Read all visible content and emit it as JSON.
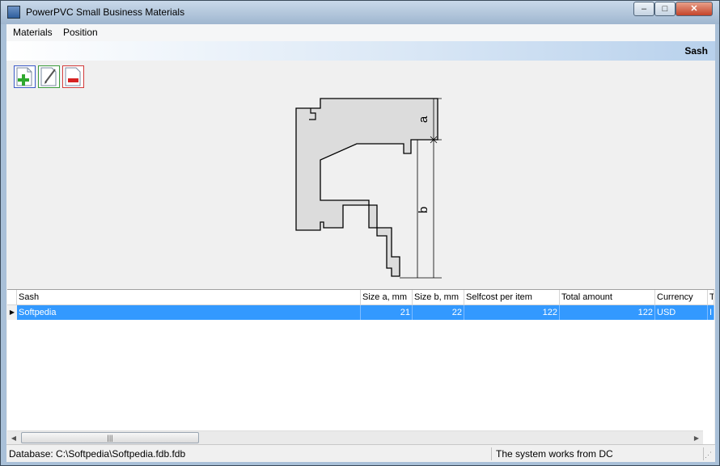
{
  "window": {
    "title": "PowerPVC Small Business Materials",
    "minimize": "–",
    "maximize": "□",
    "close": "✕"
  },
  "menu": {
    "items": [
      "Materials",
      "Position"
    ]
  },
  "banner": {
    "title": "Sash"
  },
  "toolbar": {
    "add_icon": "add-icon",
    "edit_icon": "edit-icon",
    "delete_icon": "delete-icon"
  },
  "drawing": {
    "label_a": "a",
    "label_b": "b"
  },
  "grid": {
    "columns": [
      "Sash",
      "Size a, mm",
      "Size b, mm",
      "Selfcost per item",
      "Total amount",
      "Currency",
      "T"
    ],
    "rows": [
      {
        "name": "Softpedia",
        "size_a": "21",
        "size_b": "22",
        "selfcost": "122",
        "total": "122",
        "currency": "USD",
        "t": "I"
      }
    ]
  },
  "status": {
    "database": "Database: C:\\Softpedia\\Softpedia.fdb.fdb",
    "mode": "The system works from DC"
  },
  "colors": {
    "selection": "#3399ff",
    "banner_start": "#ffffff",
    "banner_end": "#b8d1ec"
  }
}
